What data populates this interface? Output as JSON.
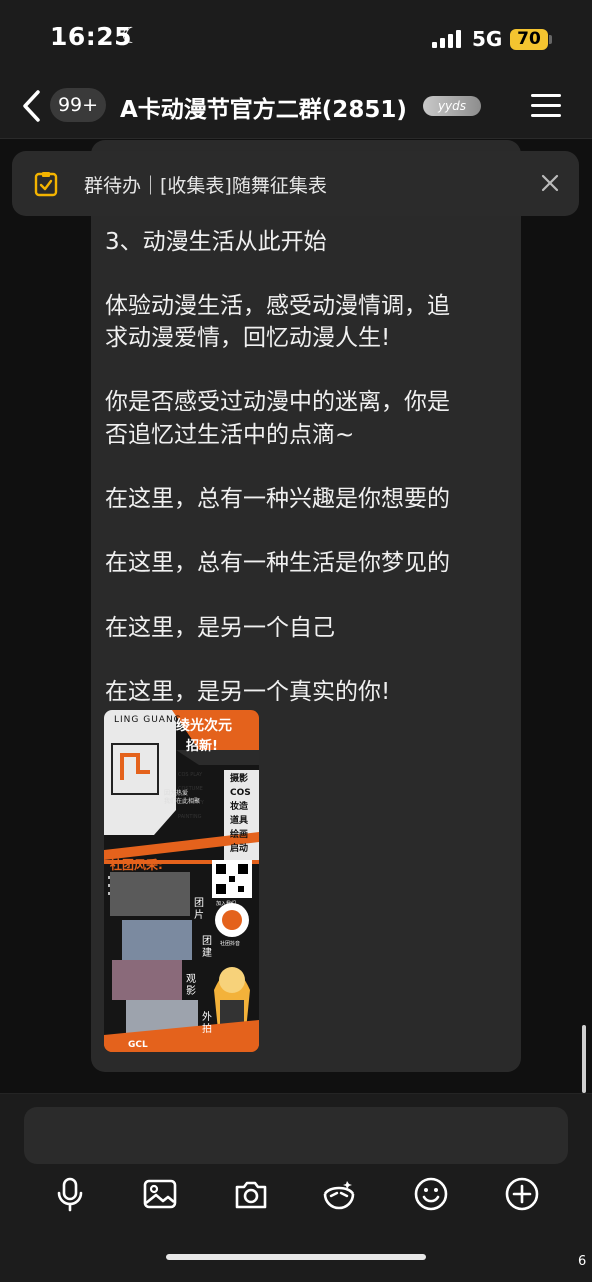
{
  "status_bar": {
    "time": "16:25",
    "network": "5G",
    "battery": "70"
  },
  "nav": {
    "unread_badge": "99+",
    "title": "A卡动漫节官方二群(2851)",
    "title_tag": "yyds"
  },
  "todo_banner": {
    "text": "群待办｜[收集表]随舞征集表"
  },
  "message": {
    "lines": [
      "3、动漫生活从此开始",
      "体验动漫生活，感受动漫情调，追",
      "求动漫爱情，回忆动漫人生!",
      "你是否感受过动漫中的迷离，你是",
      "否追忆过生活中的点滴~",
      "在这里，总有一种兴趣是你想要的",
      "在这里，总有一种生活是你梦见的",
      "在这里，是另一个自己",
      "在这里，是另一个真实的你!"
    ]
  },
  "poster": {
    "header": "LING GUANG",
    "title_1": "绫光次元",
    "title_2": "招新!",
    "categories": [
      "摄影",
      "COS",
      "妆造",
      "道具",
      "绘画",
      "启动"
    ],
    "category_en": [
      "COS PLAY",
      "COSTUME",
      "PROPERTY",
      "PAINTING"
    ],
    "slogan_1": "因为热爱",
    "slogan_2": "我们在此相聚",
    "section": "社团风采:",
    "vertical_labels": [
      "团片",
      "团建",
      "观影",
      "外拍"
    ],
    "qr_caption_1": "加入我们",
    "qr_caption_2": "社团抖音",
    "footer": "GCL"
  },
  "bottom_bar": {
    "tools": [
      "microphone-icon",
      "image-icon",
      "camera-icon",
      "sticker-icon",
      "emoji-icon",
      "plus-icon"
    ]
  },
  "corner_digit": "6"
}
